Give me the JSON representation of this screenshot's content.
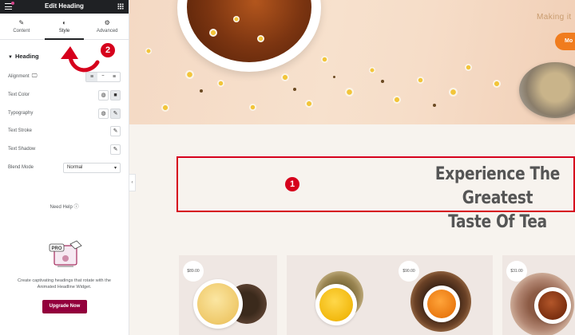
{
  "panel": {
    "title": "Edit Heading",
    "tabs": [
      {
        "label": "Content",
        "icon": "pencil-icon"
      },
      {
        "label": "Style",
        "icon": "half-circle-icon"
      },
      {
        "label": "Advanced",
        "icon": "gear-icon"
      }
    ],
    "section": "Heading",
    "controls": {
      "alignment": "Alignment",
      "text_color": "Text Color",
      "typography": "Typography",
      "text_stroke": "Text Stroke",
      "text_shadow": "Text Shadow",
      "blend_mode": "Blend Mode",
      "blend_mode_value": "Normal"
    },
    "need_help": "Need Help",
    "promo_badge": "PRO",
    "promo_text": "Create captivating headings that rotate with the Animated Headline Widget.",
    "upgrade_label": "Upgrade Now"
  },
  "markers": {
    "one": "1",
    "two": "2"
  },
  "hero": {
    "tagline": "Making it",
    "button_label": "Mo"
  },
  "heading": {
    "line1": "Experience The Greatest",
    "line2": "Taste Of Tea"
  },
  "products": [
    {
      "price": "$89.00"
    },
    {
      "price": ""
    },
    {
      "price": "$90.00"
    },
    {
      "price": "$31.00"
    }
  ],
  "colors": {
    "accent_red": "#d6001c",
    "upgrade_button": "#93003c",
    "hero_button": "#f07c1e",
    "heading_text": "#555555"
  }
}
